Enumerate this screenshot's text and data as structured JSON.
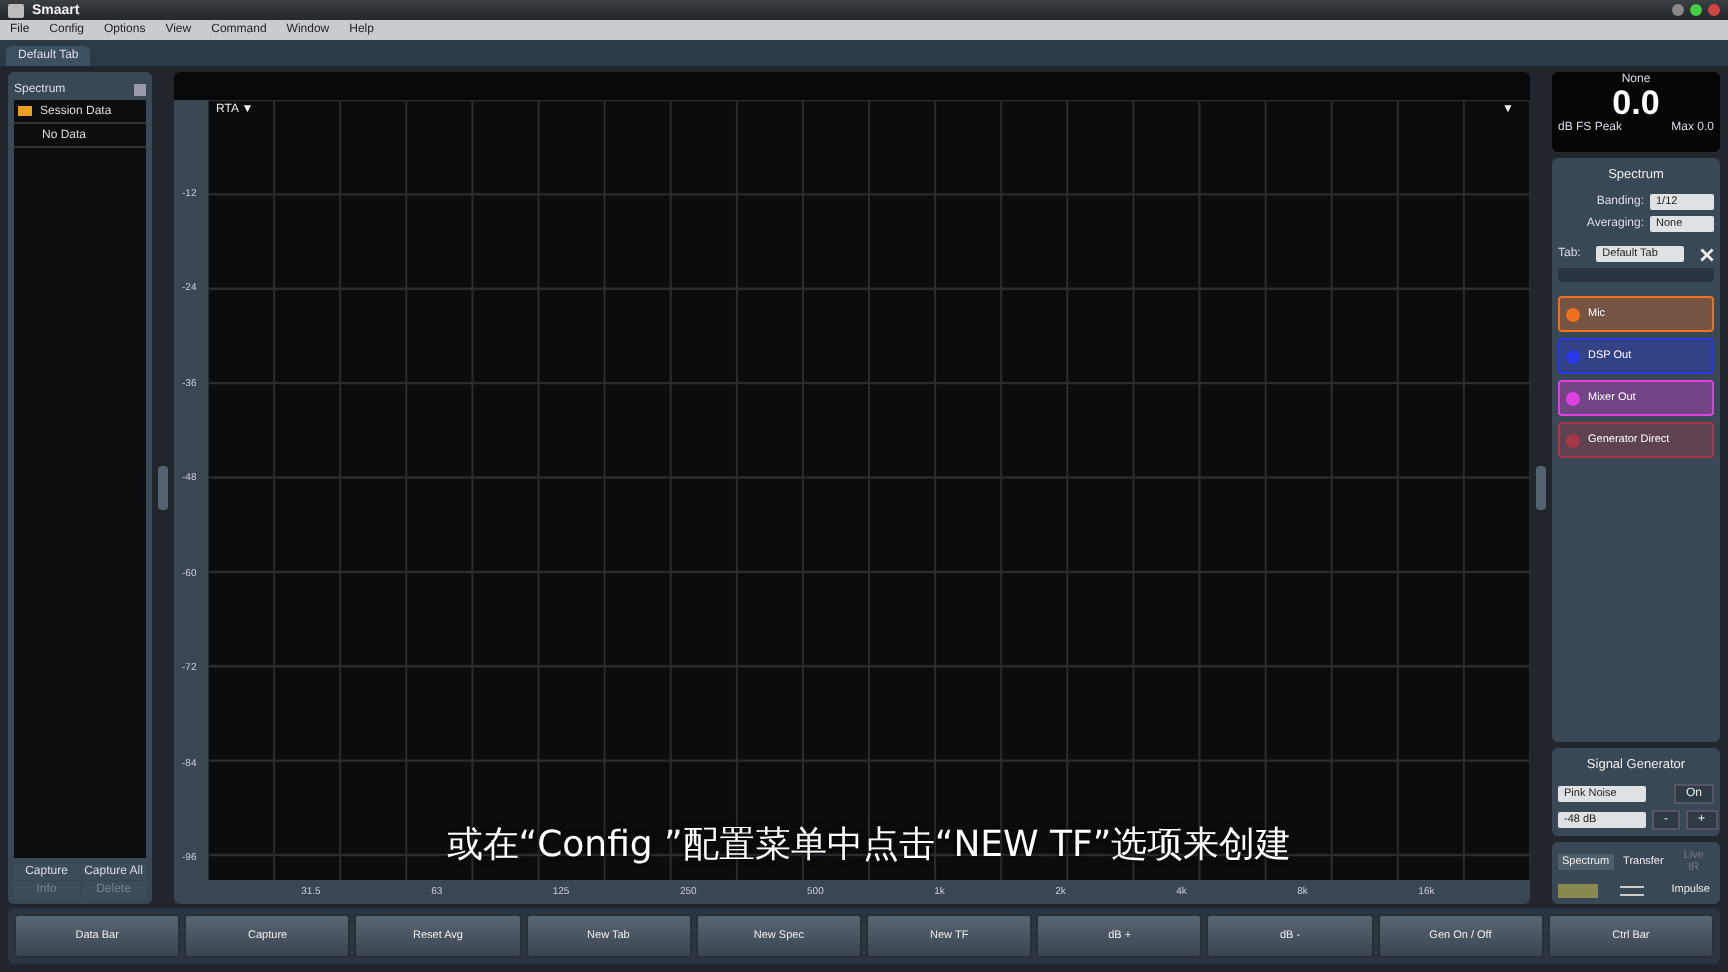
{
  "window": {
    "title": "Smaart"
  },
  "menu": [
    "File",
    "Config",
    "Options",
    "View",
    "Command",
    "Window",
    "Help"
  ],
  "tabs": [
    {
      "label": "Default Tab",
      "selected": true
    }
  ],
  "data_bar": {
    "title": "Spectrum",
    "items": [
      {
        "label": "Session Data",
        "kind": "folder"
      },
      {
        "label": "No Data",
        "kind": "item"
      }
    ],
    "buttons": [
      {
        "label": "Capture",
        "disabled": false
      },
      {
        "label": "Capture All",
        "disabled": false
      },
      {
        "label": "Info",
        "disabled": true
      },
      {
        "label": "Delete",
        "disabled": true
      }
    ]
  },
  "plot": {
    "mode": "RTA ▼",
    "corner": "▼",
    "y_ticks": [
      "-12",
      "-24",
      "-36",
      "-48",
      "-60",
      "-72",
      "-84",
      "-96"
    ],
    "x_ticks": [
      "31.5",
      "63",
      "125",
      "250",
      "500",
      "1k",
      "2k",
      "4k",
      "8k",
      "16k"
    ]
  },
  "subtitle": "或在“Config ”配置菜单中点击“NEW TF”选项来创建",
  "meter": {
    "source": "None",
    "value": "0.0",
    "unit": "dB FS Peak",
    "max": "Max 0.0"
  },
  "spectrum": {
    "title": "Spectrum",
    "banding_label": "Banding:",
    "banding": "1/12",
    "averaging_label": "Averaging:",
    "averaging": "None",
    "tab_label": "Tab:",
    "tab": "Default Tab"
  },
  "channels": [
    {
      "name": "Mic",
      "color": "#f07020"
    },
    {
      "name": "DSP Out",
      "color": "#2838e8"
    },
    {
      "name": "Mixer Out",
      "color": "#e040e0"
    },
    {
      "name": "Generator Direct",
      "color": "#a83848"
    }
  ],
  "signal_generator": {
    "title": "Signal Generator",
    "signal": "Pink Noise",
    "level": "-48 dB",
    "on_label": "On",
    "minus": "-",
    "plus": "+"
  },
  "modes": [
    {
      "label": "Spectrum",
      "selected": true,
      "disabled": false
    },
    {
      "label": "Transfer",
      "selected": false,
      "disabled": false
    },
    {
      "label": "Live IR",
      "selected": false,
      "disabled": true
    }
  ],
  "impulse": "Impulse",
  "command_bar": [
    "Data Bar",
    "Capture",
    "Reset Avg",
    "New Tab",
    "New Spec",
    "New TF",
    "dB +",
    "dB -",
    "Gen On / Off",
    "Ctrl Bar"
  ]
}
